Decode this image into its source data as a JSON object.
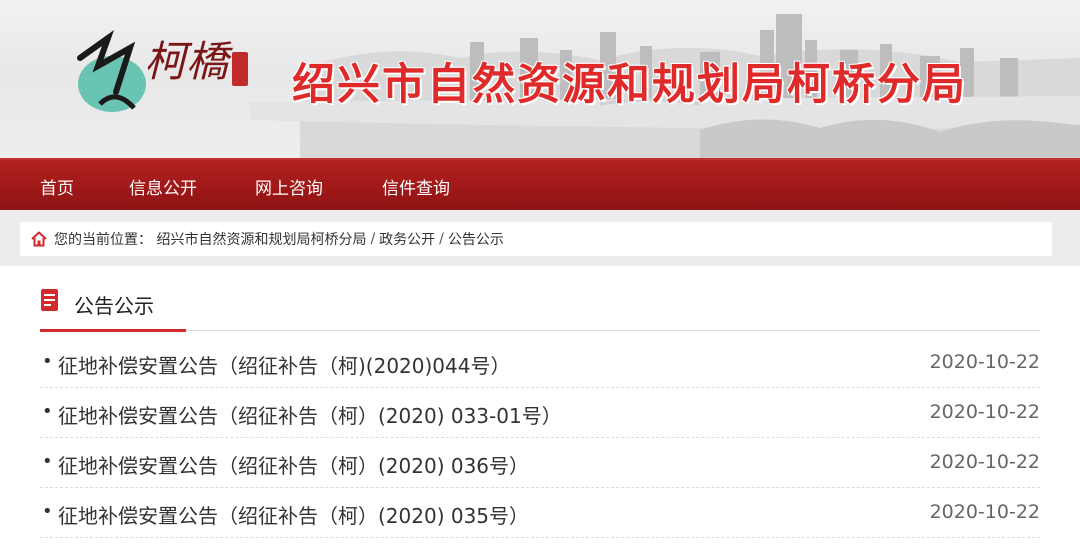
{
  "header": {
    "site_title": "绍兴市自然资源和规划局柯桥分局",
    "logo_text": "柯橋"
  },
  "nav": {
    "items": [
      {
        "label": "首页"
      },
      {
        "label": "信息公开"
      },
      {
        "label": "网上咨询"
      },
      {
        "label": "信件查询"
      }
    ]
  },
  "breadcrumb": {
    "prefix": "您的当前位置：",
    "items": [
      {
        "label": "绍兴市自然资源和规划局柯桥分局"
      },
      {
        "label": "政务公开"
      },
      {
        "label": "公告公示"
      }
    ],
    "separator": "/"
  },
  "section": {
    "title": "公告公示",
    "bullet": "•",
    "items": [
      {
        "title": "征地补偿安置公告（绍征补告（柯)(2020)044号）",
        "date": "2020-10-22"
      },
      {
        "title": "征地补偿安置公告（绍征补告（柯）(2020) 033-01号）",
        "date": "2020-10-22"
      },
      {
        "title": "征地补偿安置公告（绍征补告（柯）(2020) 036号）",
        "date": "2020-10-22"
      },
      {
        "title": "征地补偿安置公告（绍征补告（柯）(2020) 035号）",
        "date": "2020-10-22"
      }
    ]
  },
  "colors": {
    "brand_red": "#a01818",
    "title_red": "#e02a2a",
    "accent_underline": "#d42a2a"
  }
}
